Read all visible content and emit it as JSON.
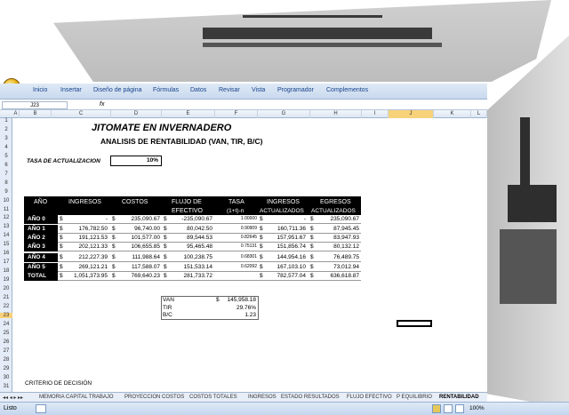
{
  "ribbon_tabs": [
    "Inicio",
    "Insertar",
    "Diseño de página",
    "Fórmulas",
    "Datos",
    "Revisar",
    "Vista",
    "Programador",
    "Complementos"
  ],
  "name_box": "J23",
  "fx": "fx",
  "columns": [
    "A",
    "B",
    "C",
    "D",
    "E",
    "F",
    "G",
    "H",
    "I",
    "J",
    "K",
    "L"
  ],
  "rows": [
    "1",
    "2",
    "3",
    "4",
    "5",
    "6",
    "7",
    "8",
    "9",
    "10",
    "11",
    "12",
    "13",
    "14",
    "15",
    "16",
    "17",
    "18",
    "19",
    "20",
    "21",
    "22",
    "23",
    "24",
    "25",
    "26",
    "27",
    "28",
    "29",
    "30",
    "31"
  ],
  "sheet": {
    "title": "JITOMATE EN INVERNADERO",
    "subtitle": "ANALISIS DE RENTABILIDAD (VAN, TIR, B/C)",
    "rate_label": "TASA DE ACTUALIZACION",
    "rate_value": "10%",
    "headers": [
      "AÑO",
      "INGRESOS",
      "COSTOS",
      "FLUJO DE",
      "TASA",
      "INGRESOS",
      "EGRESOS"
    ],
    "headers2": [
      "",
      "",
      "",
      "EFECTIVO",
      "(1+t)-n",
      "ACTUALIZADOS",
      "ACTUALIZADOS"
    ],
    "table": [
      [
        "AÑO 0",
        "$",
        "-",
        "$",
        "235,090.67",
        "$",
        "-235,090.67",
        "1.00000",
        "$",
        "-",
        "$",
        "235,090.67"
      ],
      [
        "AÑO 1",
        "$",
        "176,782.50",
        "$",
        "96,740.00",
        "$",
        "80,042.50",
        "0.90909",
        "$",
        "160,711.36",
        "$",
        "87,945.45"
      ],
      [
        "AÑO 2",
        "$",
        "191,121.53",
        "$",
        "101,577.00",
        "$",
        "89,544.53",
        "0.82645",
        "$",
        "157,951.67",
        "$",
        "83,947.93"
      ],
      [
        "AÑO 3",
        "$",
        "202,121.33",
        "$",
        "106,655.85",
        "$",
        "95,465.48",
        "0.75131",
        "$",
        "151,856.74",
        "$",
        "80,132.12"
      ],
      [
        "AÑO 4",
        "$",
        "212,227.39",
        "$",
        "111,988.64",
        "$",
        "100,238.75",
        "0.68301",
        "$",
        "144,954.16",
        "$",
        "76,489.75"
      ],
      [
        "AÑO 5",
        "$",
        "269,121.21",
        "$",
        "117,588.07",
        "$",
        "151,533.14",
        "0.62092",
        "$",
        "167,103.10",
        "$",
        "73,012.94"
      ]
    ],
    "total": [
      "TOTAL",
      "$",
      "1,051,373.95",
      "$",
      "769,640.23",
      "$",
      "281,733.72",
      "",
      "$",
      "782,577.04",
      "$",
      "636,618.87"
    ],
    "van_label": "VAN",
    "van_value": "145,958.18",
    "van_cur": "$",
    "tir_label": "TIR",
    "tir_value": "29.76%",
    "bc_label": "B/C",
    "bc_value": "1.23",
    "criterio": "CRITERIO DE DECISIÓN"
  },
  "sheet_tabs": [
    "MEMORIA CAPITAL TRABAJO",
    "PROYECCION COSTOS",
    "COSTOS TOTALES",
    "INGRESOS",
    "ESTADO RESULTADOS",
    "FLUJO EFECTIVO",
    "P EQUILIBRIO",
    "RENTABILIDAD"
  ],
  "status": {
    "left": "Listo",
    "zoom": "100%"
  },
  "colors": {
    "ribbon": "#dfe9f6",
    "header_bg": "#000000",
    "accent": "#15428b"
  }
}
